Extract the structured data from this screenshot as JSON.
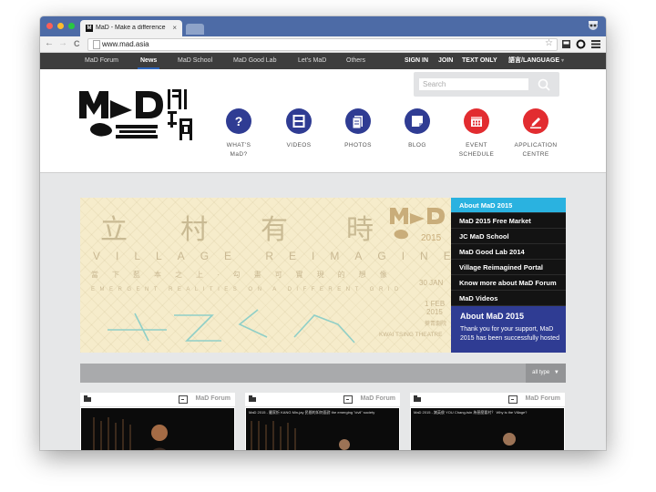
{
  "browser": {
    "tab_title": "MaD - Make a difference",
    "favicon_letter": "M",
    "close_glyph": "×",
    "url": "www.mad.asia",
    "back": "←",
    "forward": "→",
    "reload": "C",
    "star": "☆"
  },
  "site_nav": {
    "left": [
      "MaD Forum",
      "News",
      "MaD School",
      "MaD Good Lab",
      "Let's MaD",
      "Others"
    ],
    "active": "News",
    "right": [
      "SIGN IN",
      "JOIN",
      "TEXT ONLY",
      "語言/LANGUAGE"
    ]
  },
  "search": {
    "placeholder": "Search"
  },
  "main_nav": [
    {
      "label": "WHAT'S\nMaD?",
      "icon": "question-icon",
      "color": "#2f3c93"
    },
    {
      "label": "VIDEOS",
      "icon": "film-icon",
      "color": "#2f3c93"
    },
    {
      "label": "PHOTOS",
      "icon": "photo-icon",
      "color": "#2f3c93"
    },
    {
      "label": "BLOG",
      "icon": "note-icon",
      "color": "#2f3c93"
    },
    {
      "label": "EVENT\nSCHEDULE",
      "icon": "calendar-icon",
      "color": "#e22c30"
    },
    {
      "label": "APPLICATION\nCENTRE",
      "icon": "pencil-icon",
      "color": "#e22c30"
    }
  ],
  "banner": {
    "chars": [
      "立",
      "村",
      "有",
      "時"
    ],
    "title_en": "VILLAGE REIMAGINED",
    "subtitle_cn": "當下藍本之上·勾畫可實現的想像",
    "subtitle_en": "EMERGENT REALITIES ON A DIFFERENT GRID",
    "date_start": "30 JAN",
    "date_end": "1 FEB",
    "year": "2015",
    "venue_cn": "葵青劇院",
    "venue_en": "KWAI TSING THEATRE",
    "logo_year": "2015"
  },
  "side_menu": [
    "About MaD 2015",
    "MaD 2015 Free Market",
    "JC MaD School",
    "MaD Good Lab 2014",
    "Village Reimagined Portal",
    "Know more about MaD Forum",
    "MaD Videos"
  ],
  "side_menu_active": "About MaD 2015",
  "promo": {
    "title": "About MaD 2015",
    "body": "Thank you for your support, MaD 2015 has been successfully hosted"
  },
  "filter": {
    "label": "all type"
  },
  "cards": [
    {
      "category": "MaD Forum",
      "caption": ""
    },
    {
      "category": "MaD Forum",
      "caption": "MaD 2015 - 嚴家忻 KANG Min-jay 民間的如何面對 the emerging \"civil\" society"
    },
    {
      "category": "MaD Forum",
      "caption": "MaD 2015 - 謝英俊 YOU Chang-tsin 為甚麼要村？ Why is the Village?"
    }
  ],
  "colors": {
    "chrome_blue": "#4d6ba6",
    "nav_dark": "#3d3d3d",
    "brand_blue": "#2f3c93",
    "brand_red": "#e22c30",
    "menu_active": "#2ab2e0",
    "banner_bg": "#f6eccb"
  }
}
